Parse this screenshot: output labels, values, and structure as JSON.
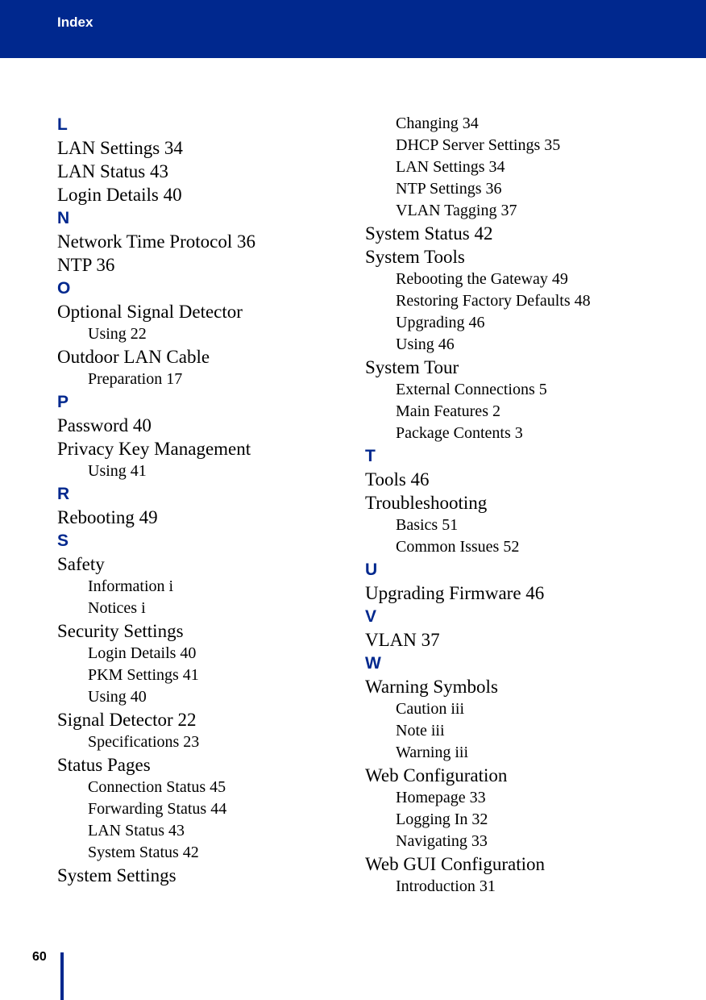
{
  "header": {
    "title": "Index"
  },
  "footer": {
    "page_number": "60"
  },
  "columns": [
    {
      "entries": [
        {
          "type": "letter",
          "text": "L"
        },
        {
          "type": "main",
          "text": "LAN Settings 34"
        },
        {
          "type": "main",
          "text": "LAN Status 43"
        },
        {
          "type": "main",
          "text": "Login Details 40"
        },
        {
          "type": "letter",
          "text": "N"
        },
        {
          "type": "main",
          "text": "Network Time Protocol 36"
        },
        {
          "type": "main",
          "text": "NTP 36"
        },
        {
          "type": "letter",
          "text": "O"
        },
        {
          "type": "main",
          "text": "Optional Signal Detector"
        },
        {
          "type": "sub",
          "text": "Using 22"
        },
        {
          "type": "main",
          "text": "Outdoor LAN Cable"
        },
        {
          "type": "sub",
          "text": "Preparation 17"
        },
        {
          "type": "letter",
          "text": "P"
        },
        {
          "type": "main",
          "text": "Password 40"
        },
        {
          "type": "main",
          "text": "Privacy Key Management"
        },
        {
          "type": "sub",
          "text": "Using 41"
        },
        {
          "type": "letter",
          "text": "R"
        },
        {
          "type": "main",
          "text": "Rebooting 49"
        },
        {
          "type": "letter",
          "text": "S"
        },
        {
          "type": "main",
          "text": "Safety"
        },
        {
          "type": "sub",
          "text": "Information i"
        },
        {
          "type": "sub",
          "text": "Notices i"
        },
        {
          "type": "main",
          "text": "Security Settings"
        },
        {
          "type": "sub",
          "text": "Login Details 40"
        },
        {
          "type": "sub",
          "text": "PKM Settings 41"
        },
        {
          "type": "sub",
          "text": "Using 40"
        },
        {
          "type": "main",
          "text": "Signal Detector 22"
        },
        {
          "type": "sub",
          "text": "Specifications 23"
        },
        {
          "type": "main",
          "text": "Status Pages"
        },
        {
          "type": "sub",
          "text": "Connection Status 45"
        },
        {
          "type": "sub",
          "text": "Forwarding Status 44"
        },
        {
          "type": "sub",
          "text": "LAN Status 43"
        },
        {
          "type": "sub",
          "text": "System Status 42"
        },
        {
          "type": "main",
          "text": "System Settings"
        }
      ]
    },
    {
      "entries": [
        {
          "type": "sub",
          "text": "Changing 34"
        },
        {
          "type": "sub",
          "text": "DHCP Server Settings 35"
        },
        {
          "type": "sub",
          "text": "LAN Settings 34"
        },
        {
          "type": "sub",
          "text": "NTP Settings 36"
        },
        {
          "type": "sub",
          "text": "VLAN Tagging 37"
        },
        {
          "type": "main",
          "text": "System Status 42"
        },
        {
          "type": "main",
          "text": "System Tools"
        },
        {
          "type": "sub",
          "text": "Rebooting the Gateway 49"
        },
        {
          "type": "sub",
          "text": "Restoring Factory Defaults 48"
        },
        {
          "type": "sub",
          "text": "Upgrading 46"
        },
        {
          "type": "sub",
          "text": "Using 46"
        },
        {
          "type": "main",
          "text": "System Tour"
        },
        {
          "type": "sub",
          "text": "External Connections 5"
        },
        {
          "type": "sub",
          "text": "Main Features 2"
        },
        {
          "type": "sub",
          "text": "Package Contents 3"
        },
        {
          "type": "letter",
          "text": "T"
        },
        {
          "type": "main",
          "text": "Tools 46"
        },
        {
          "type": "main",
          "text": "Troubleshooting"
        },
        {
          "type": "sub",
          "text": "Basics 51"
        },
        {
          "type": "sub",
          "text": "Common Issues 52"
        },
        {
          "type": "letter",
          "text": "U"
        },
        {
          "type": "main",
          "text": "Upgrading Firmware 46"
        },
        {
          "type": "letter",
          "text": "V"
        },
        {
          "type": "main",
          "text": "VLAN 37"
        },
        {
          "type": "letter",
          "text": "W"
        },
        {
          "type": "main",
          "text": "Warning Symbols"
        },
        {
          "type": "sub",
          "text": "Caution iii"
        },
        {
          "type": "sub",
          "text": "Note iii"
        },
        {
          "type": "sub",
          "text": "Warning iii"
        },
        {
          "type": "main",
          "text": "Web Configuration"
        },
        {
          "type": "sub",
          "text": "Homepage 33"
        },
        {
          "type": "sub",
          "text": "Logging In 32"
        },
        {
          "type": "sub",
          "text": "Navigating 33"
        },
        {
          "type": "main",
          "text": "Web GUI Configuration"
        },
        {
          "type": "sub",
          "text": "Introduction 31"
        }
      ]
    }
  ]
}
